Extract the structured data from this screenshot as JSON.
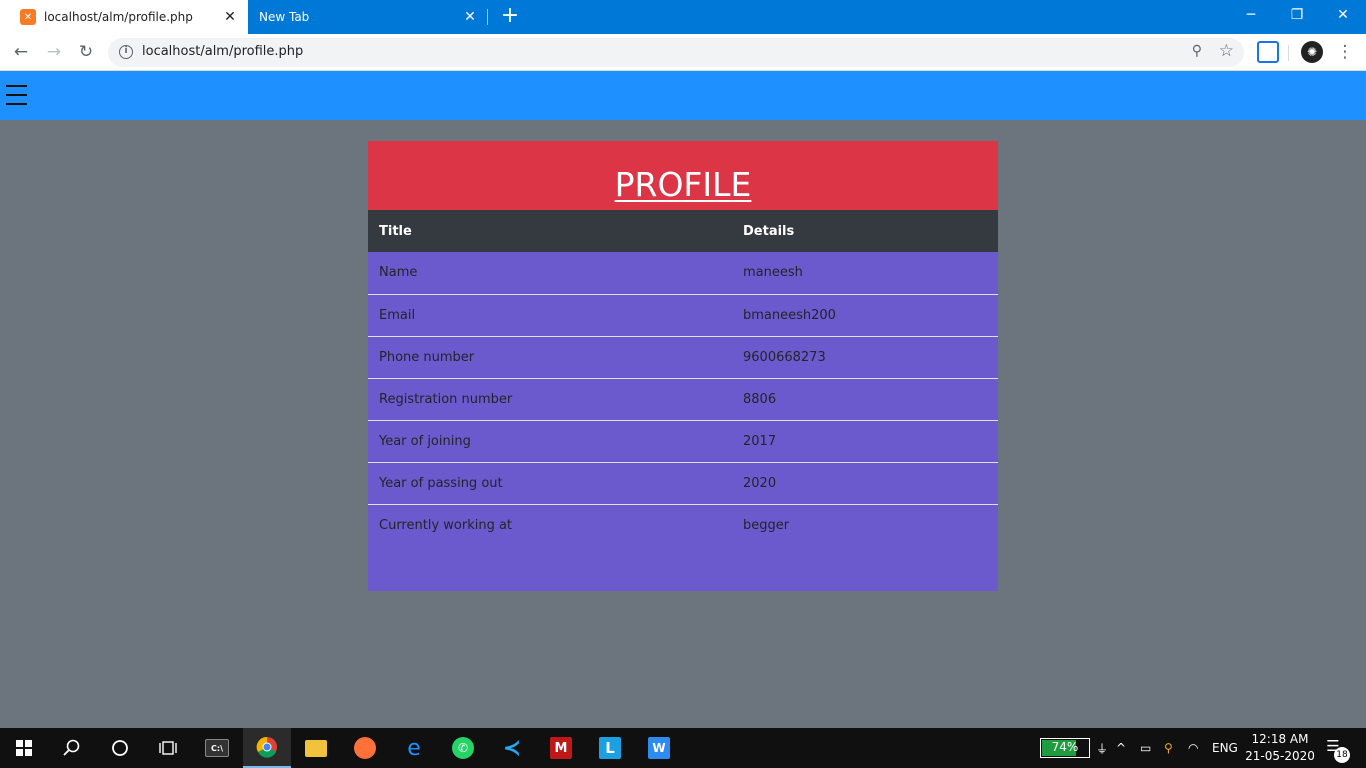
{
  "browser": {
    "active_tab_title": "localhost/alm/profile.php",
    "inactive_tab_title": "New Tab",
    "url": "localhost/alm/profile.php"
  },
  "page": {
    "heading": "PROFILE",
    "columns": [
      "Title",
      "Details"
    ],
    "rows": [
      {
        "title": "Name",
        "detail": "maneesh"
      },
      {
        "title": "Email",
        "detail": "bmaneesh200"
      },
      {
        "title": "Phone number",
        "detail": "9600668273"
      },
      {
        "title": "Registration number",
        "detail": "8806"
      },
      {
        "title": "Year of joining",
        "detail": "2017"
      },
      {
        "title": "Year of passing out",
        "detail": "2020"
      },
      {
        "title": "Currently working at",
        "detail": "begger"
      }
    ]
  },
  "taskbar": {
    "battery_percent": "74%",
    "battery_level": 0.74,
    "language": "ENG",
    "time": "12:18 AM",
    "date": "21-05-2020",
    "notification_count": "18",
    "apps": [
      "start-icon",
      "search-icon",
      "cortana-icon",
      "task-view-icon",
      "terminal-icon",
      "chrome-icon",
      "file-explorer-icon",
      "firefox-icon",
      "edge-icon",
      "whatsapp-icon",
      "vscode-icon",
      "mcafee-icon",
      "l-app-icon",
      "w-app-icon"
    ]
  },
  "colors": {
    "tabstrip": "#0078d7",
    "navbar": "#1e90ff",
    "background": "#6c757d",
    "card_header": "#dc3545",
    "table_header": "#343a40",
    "table_body": "#6a5acd"
  }
}
